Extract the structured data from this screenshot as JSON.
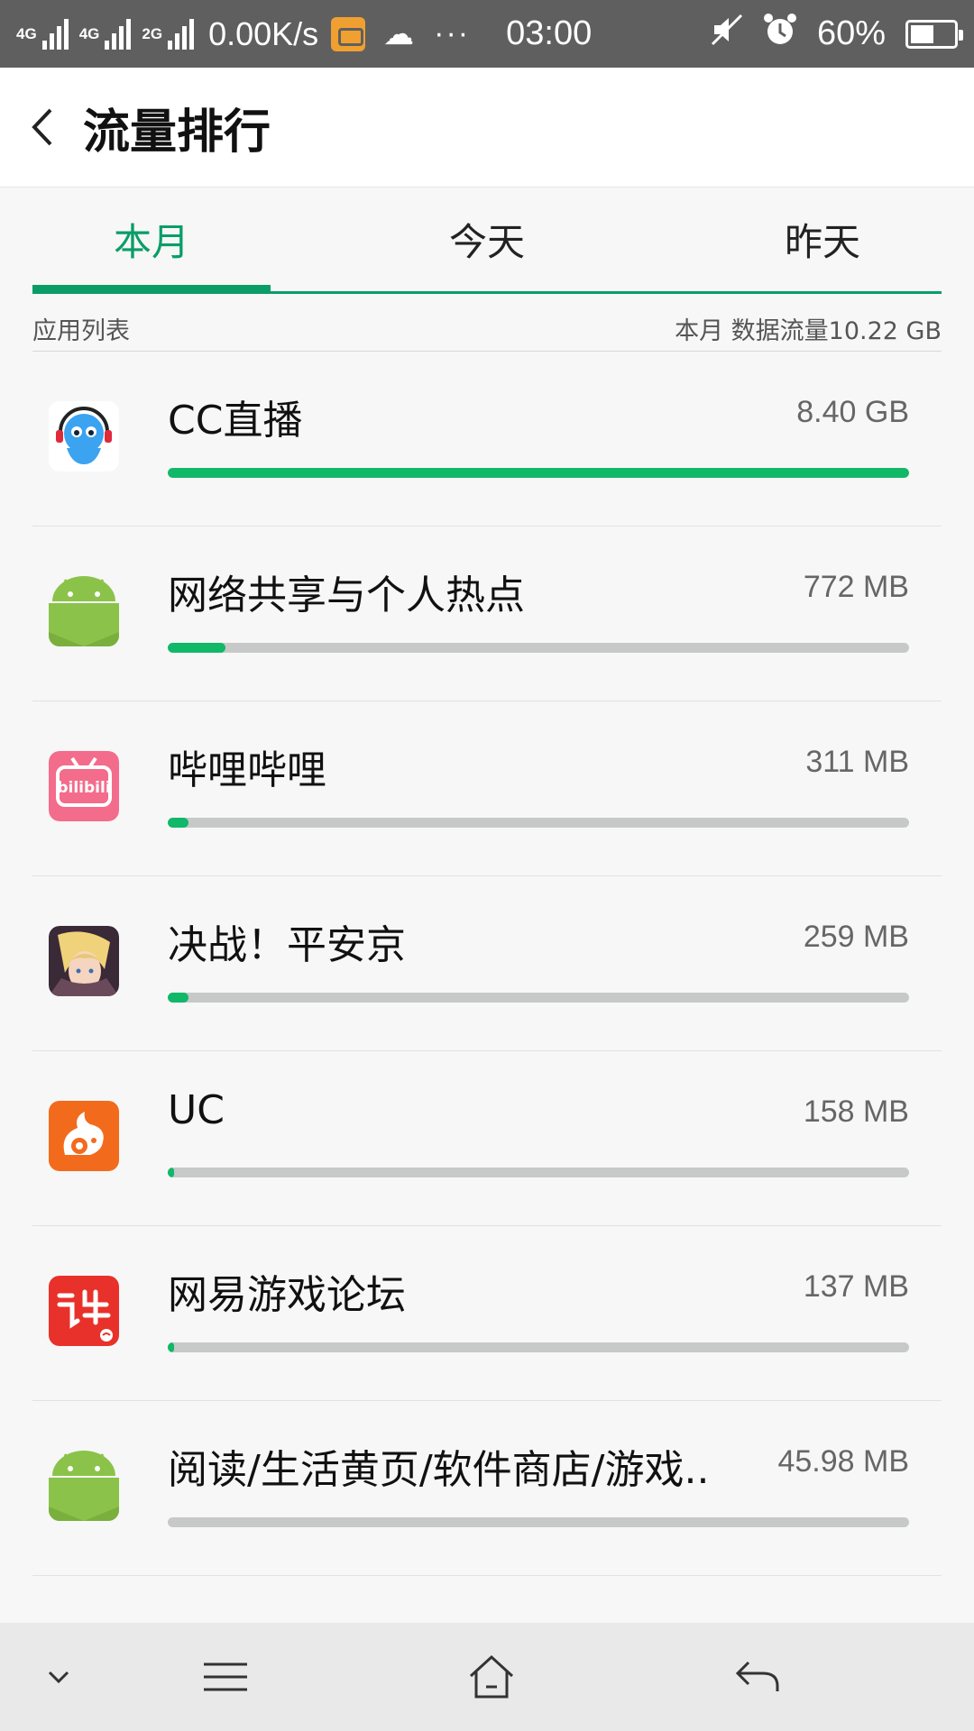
{
  "status_bar": {
    "network_1": "4G",
    "network_2": "4G",
    "network_3": "2G",
    "speed": "0.00K/s",
    "more": "···",
    "time": "03:00",
    "battery_level": 0.6,
    "battery_pct": "60%"
  },
  "header": {
    "title": "流量排行"
  },
  "tabs": [
    {
      "label": "本月",
      "active": true
    },
    {
      "label": "今天",
      "active": false
    },
    {
      "label": "昨天",
      "active": false
    }
  ],
  "list_header": {
    "left": "应用列表",
    "right": "本月 数据流量10.22 GB"
  },
  "apps": [
    {
      "name": "CC直播",
      "size": "8.40 GB",
      "usage_fraction": 1.0,
      "icon": "cc-live-icon"
    },
    {
      "name": "网络共享与个人热点",
      "size": "772 MB",
      "usage_fraction": 0.078,
      "icon": "android-icon"
    },
    {
      "name": "哔哩哔哩",
      "size": "311 MB",
      "usage_fraction": 0.028,
      "icon": "bilibili-icon"
    },
    {
      "name": "决战！平安京",
      "size": "259 MB",
      "usage_fraction": 0.028,
      "icon": "onmyoji-arena-icon"
    },
    {
      "name": "UC",
      "size": "158 MB",
      "usage_fraction": 0.009,
      "icon": "uc-browser-icon"
    },
    {
      "name": "网易游戏论坛",
      "size": "137 MB",
      "usage_fraction": 0.009,
      "icon": "netease-forum-icon"
    },
    {
      "name": "阅读/生活黄页/软件商店/游戏..",
      "size": "45.98 MB",
      "usage_fraction": 0.0,
      "icon": "android-icon"
    }
  ],
  "colors": {
    "accent": "#0a9d68",
    "bar_fill": "#10b868",
    "bar_track": "#c7c9c8"
  }
}
